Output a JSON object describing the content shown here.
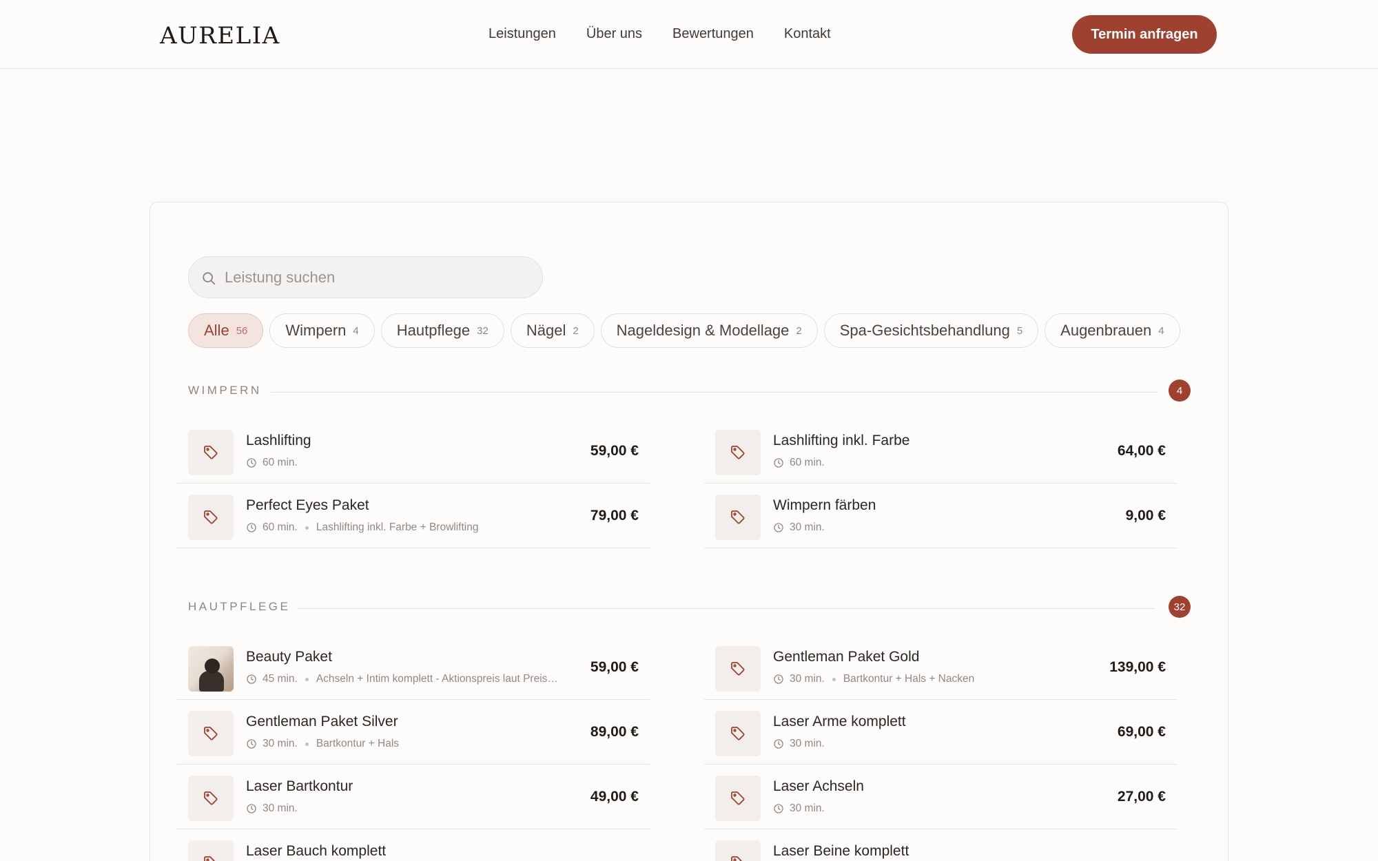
{
  "brand": {
    "logo": "AURELIA",
    "accent": "#9f4130"
  },
  "nav": {
    "items": [
      "Leistungen",
      "Über uns",
      "Bewertungen",
      "Kontakt"
    ],
    "cta": "Termin anfragen"
  },
  "search": {
    "placeholder": "Leistung suchen",
    "value": ""
  },
  "filters": [
    {
      "label": "Alle",
      "count": "56",
      "active": true
    },
    {
      "label": "Wimpern",
      "count": "4"
    },
    {
      "label": "Hautpflege",
      "count": "32"
    },
    {
      "label": "Nägel",
      "count": "2"
    },
    {
      "label": "Nageldesign & Modellage",
      "count": "2"
    },
    {
      "label": "Spa-Gesichtsbehandlung",
      "count": "5"
    },
    {
      "label": "Augenbrauen",
      "count": "4"
    }
  ],
  "sections": [
    {
      "title": "WIMPERN",
      "count": "4",
      "services": [
        {
          "name": "Lashlifting",
          "duration": "60 min.",
          "description": "",
          "price": "59,00 €",
          "icon": "tag-icon"
        },
        {
          "name": "Lashlifting inkl. Farbe",
          "duration": "60 min.",
          "description": "",
          "price": "64,00 €",
          "icon": "tag-icon"
        },
        {
          "name": "Perfect Eyes Paket",
          "duration": "60 min.",
          "description": "Lashlifting inkl. Farbe + Browlifting",
          "price": "79,00 €",
          "icon": "tag-icon"
        },
        {
          "name": "Wimpern färben",
          "duration": "30 min.",
          "description": "",
          "price": "9,00 €",
          "icon": "tag-icon"
        }
      ]
    },
    {
      "title": "HAUTPFLEGE",
      "count": "32",
      "services": [
        {
          "name": "Beauty Paket",
          "duration": "45 min.",
          "description": "Achseln + Intim komplett - Aktionspreis laut Preis…",
          "price": "59,00 €",
          "icon": "photo"
        },
        {
          "name": "Gentleman Paket Gold",
          "duration": "30 min.",
          "description": "Bartkontur + Hals + Nacken",
          "price": "139,00 €",
          "icon": "tag-icon"
        },
        {
          "name": "Gentleman Paket Silver",
          "duration": "30 min.",
          "description": "Bartkontur + Hals",
          "price": "89,00 €",
          "icon": "tag-icon"
        },
        {
          "name": "Laser Arme komplett",
          "duration": "30 min.",
          "description": "",
          "price": "69,00 €",
          "icon": "tag-icon"
        },
        {
          "name": "Laser Bartkontur",
          "duration": "30 min.",
          "description": "",
          "price": "49,00 €",
          "icon": "tag-icon"
        },
        {
          "name": "Laser Achseln",
          "duration": "30 min.",
          "description": "",
          "price": "27,00 €",
          "icon": "tag-icon"
        },
        {
          "name": "Laser Bauch komplett",
          "duration": "",
          "description": "",
          "price": "",
          "icon": "tag-icon"
        },
        {
          "name": "Laser Beine komplett",
          "duration": "",
          "description": "",
          "price": "",
          "icon": "tag-icon"
        }
      ]
    }
  ]
}
